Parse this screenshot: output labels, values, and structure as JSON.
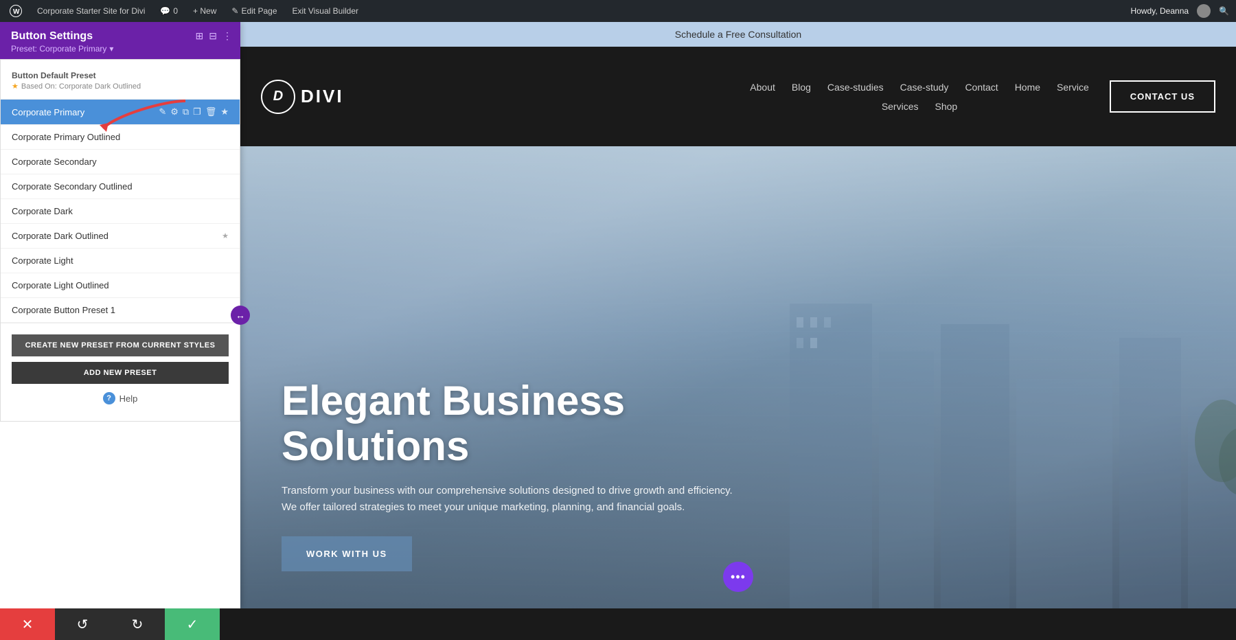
{
  "adminBar": {
    "wpIcon": "W",
    "siteName": "Corporate Starter Site for Divi",
    "commentCount": "0",
    "newLabel": "+ New",
    "editPage": "Edit Page",
    "exitBuilder": "Exit Visual Builder",
    "greeting": "Howdy, Deanna",
    "searchIcon": "🔍"
  },
  "panel": {
    "title": "Button Settings",
    "preset": "Preset: Corporate Primary",
    "presetArrow": "▾",
    "defaultPreset": {
      "title": "Button Default Preset",
      "starIcon": "★",
      "basedOn": "Based On: Corporate Dark Outlined"
    },
    "presets": [
      {
        "id": 1,
        "label": "Corporate Primary",
        "active": true
      },
      {
        "id": 2,
        "label": "Corporate Primary Outlined",
        "active": false
      },
      {
        "id": 3,
        "label": "Corporate Secondary",
        "active": false
      },
      {
        "id": 4,
        "label": "Corporate Secondary Outlined",
        "active": false
      },
      {
        "id": 5,
        "label": "Corporate Dark",
        "active": false
      },
      {
        "id": 6,
        "label": "Corporate Dark Outlined",
        "active": false,
        "starred": true
      },
      {
        "id": 7,
        "label": "Corporate Light",
        "active": false
      },
      {
        "id": 8,
        "label": "Corporate Light Outlined",
        "active": false
      },
      {
        "id": 9,
        "label": "Corporate Button Preset 1",
        "active": false
      }
    ],
    "createPresetLabel": "CREATE NEW PRESET FROM CURRENT STYLES",
    "addPresetLabel": "ADD NEW PRESET",
    "helpLabel": "Help"
  },
  "website": {
    "announcementBar": "Schedule a Free Consultation",
    "logo": {
      "icon": "D",
      "text": "DIVI"
    },
    "navLinks": [
      "About",
      "Blog",
      "Case-studies",
      "Case-study",
      "Contact",
      "Home",
      "Service"
    ],
    "navLinks2": [
      "Services",
      "Shop"
    ],
    "contactBtn": "CONTACT US",
    "hero": {
      "title": "Elegant Business Solutions",
      "subtitle": "Transform your business with our comprehensive solutions designed to drive growth and efficiency. We offer tailored strategies to meet your unique marketing, planning, and financial goals.",
      "cta": "WORK WITH US"
    }
  },
  "bottomBar": {
    "closeIcon": "✕",
    "undoIcon": "↺",
    "redoIcon": "↻",
    "saveIcon": "✓"
  },
  "icons": {
    "pencil": "✎",
    "gear": "⚙",
    "copy": "⧉",
    "duplicate": "❐",
    "trash": "🗑",
    "star": "★",
    "resize": "↔",
    "dots": "•••"
  }
}
